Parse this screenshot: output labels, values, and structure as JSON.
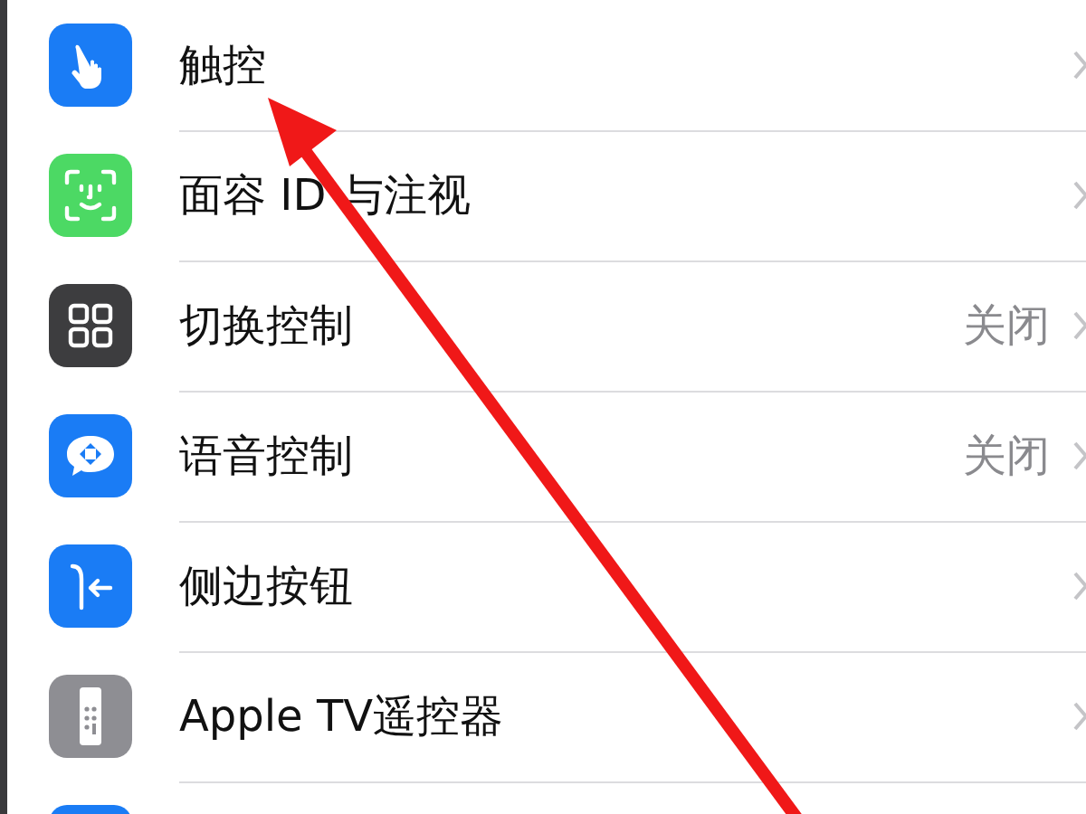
{
  "settings_list": [
    {
      "kind": "touch",
      "label": "触控"
    },
    {
      "kind": "face",
      "label": "面容 ID 与注视"
    },
    {
      "kind": "switch",
      "label": "切换控制",
      "value": "关闭"
    },
    {
      "kind": "voice",
      "label": "语音控制",
      "value": "关闭"
    },
    {
      "kind": "side",
      "label": "侧边按钮"
    },
    {
      "kind": "remote",
      "label": "Apple TV遥控器"
    },
    {
      "kind": "blank"
    }
  ],
  "annotation": {
    "kind": "arrow"
  }
}
